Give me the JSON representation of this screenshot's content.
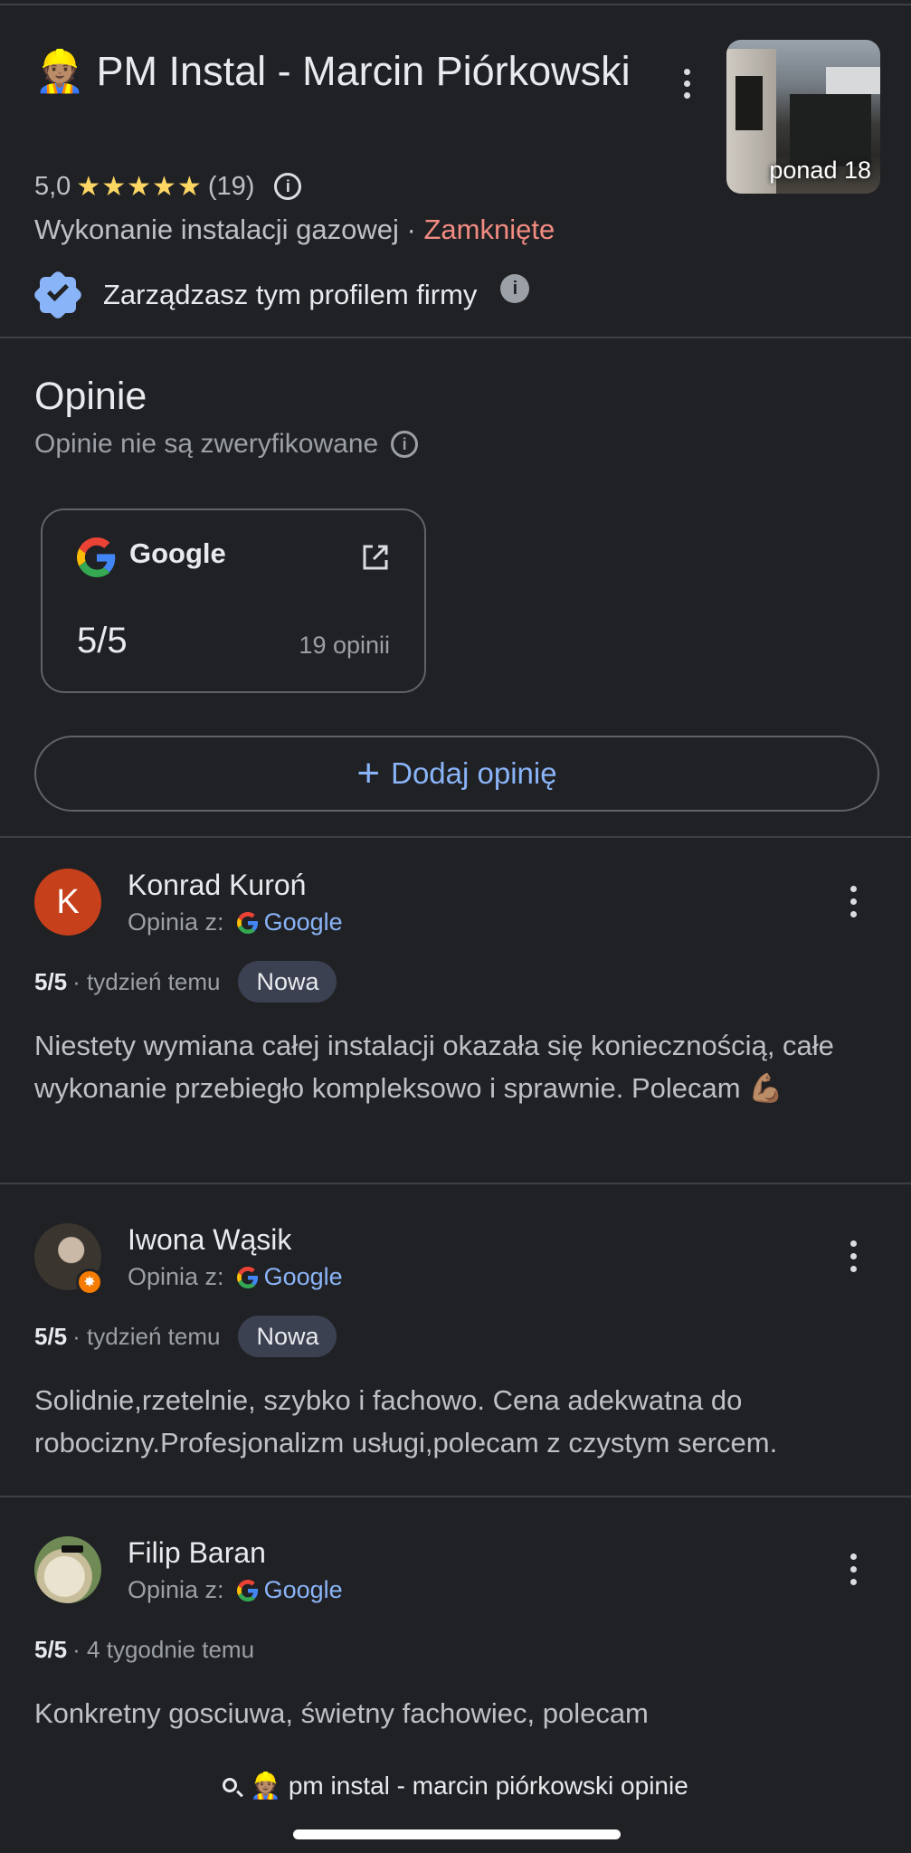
{
  "business": {
    "emoji": "👷🏽",
    "name": "PM Instal - Marcin Piórkowski",
    "rating": "5,0",
    "stars": "★★★★★",
    "review_count": "(19)",
    "category": "Wykonanie instalacji gazowej",
    "separator": " · ",
    "status": "Zamknięte",
    "photos_label": "ponad 18",
    "manage_text": "Zarządzasz tym profilem firmy"
  },
  "reviews_section": {
    "title": "Opinie",
    "subtitle": "Opinie nie są zweryfikowane",
    "source": {
      "name": "Google",
      "score": "5/5",
      "count": "19 opinii"
    },
    "add_label": "Dodaj opinię",
    "via_label": "Opinia z:",
    "via_source": "Google",
    "items": [
      {
        "initial": "K",
        "name": "Konrad Kuroń",
        "score": "5/5",
        "time": "· tydzień temu",
        "badge": "Nowa",
        "text": "Niestety wymiana całej instalacji okazała się koniecznością, całe wykonanie przebiegło kompleksowo i sprawnie. Polecam 💪🏽"
      },
      {
        "name": "Iwona Wąsik",
        "score": "5/5",
        "time": "· tydzień temu",
        "badge": "Nowa",
        "text": "Solidnie,rzetelnie, szybko i fachowo. Cena adekwatna do robocizny.Profesjonalizm usługi,polecam z czystym sercem."
      },
      {
        "name": "Filip Baran",
        "score": "5/5",
        "time": "· 4 tygodnie temu",
        "text": "Konkretny gosciuwa, świetny fachowiec, polecam"
      }
    ]
  },
  "search": {
    "query": "👷🏽 pm instal - marcin piórkowski opinie"
  },
  "colors": {
    "background": "#202124",
    "accent": "#8ab4f8",
    "closed": "#f28b82",
    "stars": "#fdd663"
  }
}
